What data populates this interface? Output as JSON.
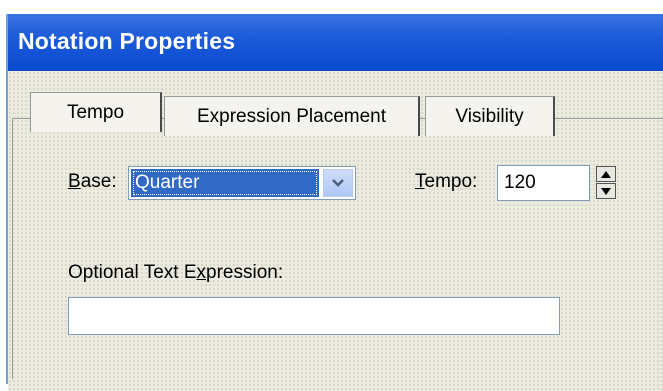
{
  "window": {
    "title": "Notation Properties"
  },
  "tabs": [
    {
      "label": "Tempo",
      "active": true
    },
    {
      "label": "Expression Placement",
      "active": false
    },
    {
      "label": "Visibility",
      "active": false
    }
  ],
  "base": {
    "label_mnemonic": "B",
    "label_rest": "ase:",
    "selected": "Quarter"
  },
  "tempo": {
    "label_mnemonic": "T",
    "label_rest": "empo:",
    "value": "120"
  },
  "expression": {
    "label_pre": "Optional Text E",
    "label_mnemonic": "x",
    "label_post": "pression:",
    "value": ""
  },
  "colors": {
    "titlebar": "#0a4ad0",
    "selection": "#316ac5",
    "dialog_bg": "#ecebe0"
  }
}
